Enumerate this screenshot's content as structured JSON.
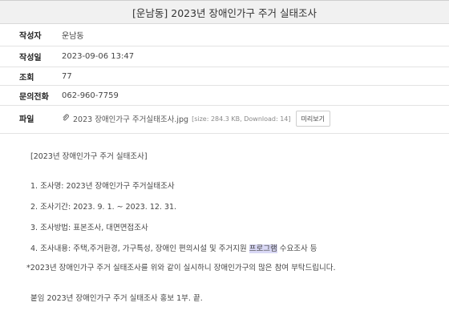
{
  "title": "[운남동] 2023년 장애인가구 주거 실태조사",
  "meta": [
    {
      "label": "작성자",
      "value": "운남동"
    },
    {
      "label": "작성일",
      "value": "2023-09-06 13:47"
    },
    {
      "label": "조회",
      "value": "77"
    },
    {
      "label": "문의전화",
      "value": "062-960-7759"
    }
  ],
  "file": {
    "label": "파일",
    "name": "2023 장애인가구 주거실태조사.jpg",
    "meta": "[size: 284.3 KB, Download: 14]",
    "preview_label": "미리보기"
  },
  "content": {
    "heading": "[2023년 장애인가구 주거 실태조사]",
    "items": [
      "1. 조사명: 2023년 장애인가구 주거실태조사",
      "2. 조사기간: 2023. 9. 1. ~ 2023. 12. 31.",
      "3. 조사방법: 표본조사, 대면면접조사"
    ],
    "item4_before": "4. 조사내용: 주택,주거환경, 가구특성, 장애인 편의시설 및 주거지원 ",
    "item4_highlight": "프로그램",
    "item4_after": " 수요조사 등",
    "note": "*2023년 장애인가구 주거 실태조사를 위와 같이 실시하니 장애인가구의 많은 참여 부탁드립니다.",
    "attachment": "붙임 2023년 장애인가구 주거 실태조사 홍보 1부. 끝."
  }
}
